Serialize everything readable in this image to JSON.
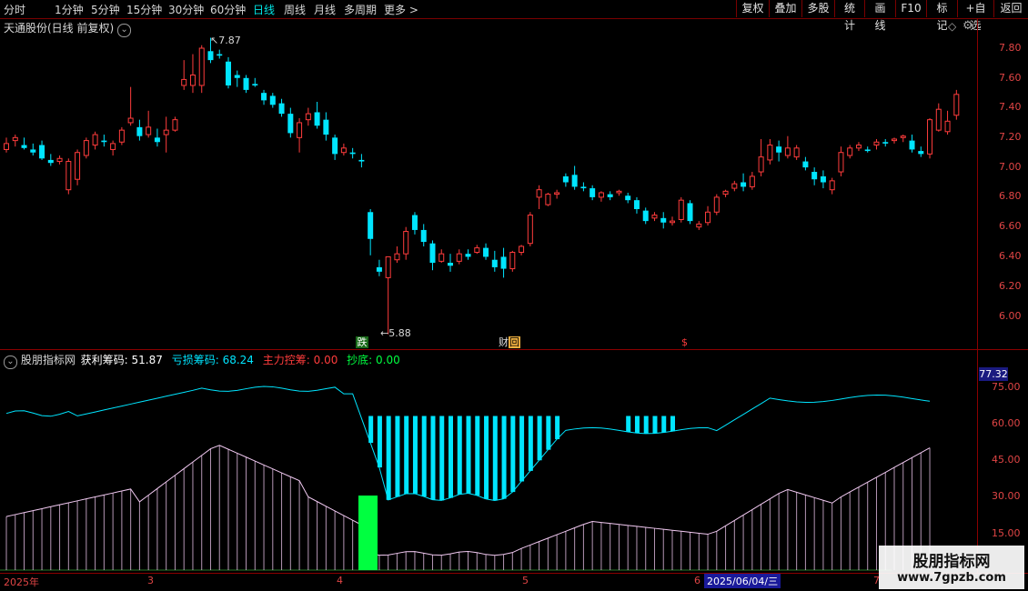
{
  "toolbar": {
    "periods": [
      "分时",
      "1分钟",
      "5分钟",
      "15分钟",
      "30分钟",
      "60分钟",
      "日线",
      "周线",
      "月线",
      "多周期",
      "更多 >"
    ],
    "active_period": "日线",
    "right_buttons": [
      "复权",
      "叠加",
      "多股",
      "统计",
      "画线",
      "F10",
      "标记",
      "+自选",
      "返回"
    ]
  },
  "main_chart": {
    "title": "天通股份(日线 前复权)",
    "high_label": "7.87",
    "low_label": "5.88",
    "markers": [
      "跌",
      "财",
      "回",
      "$"
    ],
    "y_ticks": [
      "7.80",
      "7.60",
      "7.40",
      "7.20",
      "7.00",
      "6.80",
      "6.60",
      "6.40",
      "6.20",
      "6.00"
    ],
    "colors": {
      "up": "#ff3c3c",
      "down": "#00e5ff",
      "grid": "#7a0000"
    }
  },
  "indicator": {
    "name": "股朋指标网",
    "items": [
      {
        "label": "获利筹码: 51.87",
        "color": "#ffffff"
      },
      {
        "label": "亏损筹码: 68.24",
        "color": "#00e5ff"
      },
      {
        "label": "主力控筹: 0.00",
        "color": "#ff3c3c"
      },
      {
        "label": "抄底: 0.00",
        "color": "#00ff40"
      }
    ],
    "current_value": "77.32",
    "y_ticks": [
      "75.00",
      "60.00",
      "45.00",
      "30.00",
      "15.00"
    ],
    "colors": {
      "profit": "#f0c8f0",
      "loss": "#00e5ff",
      "bottom": "#00ff40"
    }
  },
  "time_axis": {
    "labels": [
      "2025年",
      "3",
      "4",
      "5",
      "6",
      "7"
    ],
    "cursor_date": "2025/06/04/三"
  },
  "watermark": {
    "line1": "股朋指标网",
    "line2": "www.7gpzb.com"
  },
  "chart_data": {
    "type": "candlestick",
    "ohlc": [
      [
        7.12,
        7.2,
        7.1,
        7.16
      ],
      [
        7.18,
        7.22,
        7.14,
        7.2
      ],
      [
        7.15,
        7.2,
        7.12,
        7.13
      ],
      [
        7.12,
        7.16,
        7.08,
        7.1
      ],
      [
        7.15,
        7.18,
        7.05,
        7.06
      ],
      [
        7.05,
        7.09,
        7.01,
        7.03
      ],
      [
        7.04,
        7.08,
        7.02,
        7.06
      ],
      [
        6.85,
        7.06,
        6.82,
        7.04
      ],
      [
        6.92,
        7.12,
        6.88,
        7.1
      ],
      [
        7.08,
        7.2,
        7.06,
        7.18
      ],
      [
        7.15,
        7.24,
        7.12,
        7.22
      ],
      [
        7.18,
        7.22,
        7.14,
        7.17
      ],
      [
        7.12,
        7.18,
        7.08,
        7.16
      ],
      [
        7.17,
        7.27,
        7.15,
        7.25
      ],
      [
        7.3,
        7.54,
        7.28,
        7.33
      ],
      [
        7.27,
        7.32,
        7.18,
        7.21
      ],
      [
        7.22,
        7.38,
        7.2,
        7.27
      ],
      [
        7.2,
        7.26,
        7.14,
        7.17
      ],
      [
        7.22,
        7.34,
        7.1,
        7.25
      ],
      [
        7.25,
        7.34,
        7.24,
        7.32
      ],
      [
        7.55,
        7.72,
        7.52,
        7.59
      ],
      [
        7.55,
        7.76,
        7.5,
        7.62
      ],
      [
        7.55,
        7.82,
        7.5,
        7.8
      ],
      [
        7.78,
        7.87,
        7.7,
        7.72
      ],
      [
        7.76,
        7.79,
        7.73,
        7.75
      ],
      [
        7.71,
        7.74,
        7.53,
        7.55
      ],
      [
        7.62,
        7.65,
        7.54,
        7.6
      ],
      [
        7.6,
        7.62,
        7.5,
        7.52
      ],
      [
        7.56,
        7.6,
        7.54,
        7.55
      ],
      [
        7.5,
        7.52,
        7.42,
        7.45
      ],
      [
        7.48,
        7.5,
        7.4,
        7.42
      ],
      [
        7.43,
        7.46,
        7.34,
        7.36
      ],
      [
        7.36,
        7.4,
        7.2,
        7.23
      ],
      [
        7.2,
        7.33,
        7.1,
        7.3
      ],
      [
        7.32,
        7.4,
        7.28,
        7.36
      ],
      [
        7.37,
        7.44,
        7.26,
        7.28
      ],
      [
        7.32,
        7.37,
        7.18,
        7.22
      ],
      [
        7.2,
        7.22,
        7.05,
        7.09
      ],
      [
        7.1,
        7.16,
        7.08,
        7.13
      ],
      [
        7.1,
        7.13,
        7.06,
        7.09
      ],
      [
        7.05,
        7.09,
        7.0,
        7.04
      ],
      [
        6.7,
        6.72,
        6.41,
        6.52
      ],
      [
        6.33,
        6.38,
        6.27,
        6.3
      ],
      [
        6.26,
        6.4,
        5.88,
        6.4
      ],
      [
        6.38,
        6.47,
        6.36,
        6.42
      ],
      [
        6.42,
        6.6,
        6.38,
        6.57
      ],
      [
        6.68,
        6.7,
        6.55,
        6.58
      ],
      [
        6.58,
        6.62,
        6.47,
        6.5
      ],
      [
        6.49,
        6.51,
        6.31,
        6.36
      ],
      [
        6.37,
        6.45,
        6.36,
        6.42
      ],
      [
        6.36,
        6.42,
        6.3,
        6.34
      ],
      [
        6.37,
        6.45,
        6.35,
        6.42
      ],
      [
        6.42,
        6.45,
        6.38,
        6.4
      ],
      [
        6.43,
        6.48,
        6.42,
        6.46
      ],
      [
        6.46,
        6.49,
        6.38,
        6.4
      ],
      [
        6.38,
        6.44,
        6.3,
        6.33
      ],
      [
        6.4,
        6.46,
        6.26,
        6.32
      ],
      [
        6.32,
        6.44,
        6.3,
        6.43
      ],
      [
        6.43,
        6.48,
        6.41,
        6.47
      ],
      [
        6.49,
        6.7,
        6.47,
        6.68
      ],
      [
        6.8,
        6.88,
        6.72,
        6.85
      ],
      [
        6.75,
        6.83,
        6.74,
        6.82
      ],
      [
        6.82,
        6.85,
        6.79,
        6.83
      ],
      [
        6.94,
        6.96,
        6.87,
        6.9
      ],
      [
        6.95,
        7.01,
        6.85,
        6.87
      ],
      [
        6.87,
        6.9,
        6.84,
        6.86
      ],
      [
        6.86,
        6.88,
        6.78,
        6.8
      ],
      [
        6.8,
        6.84,
        6.77,
        6.83
      ],
      [
        6.82,
        6.84,
        6.78,
        6.8
      ],
      [
        6.83,
        6.85,
        6.81,
        6.84
      ],
      [
        6.81,
        6.83,
        6.76,
        6.78
      ],
      [
        6.78,
        6.8,
        6.69,
        6.72
      ],
      [
        6.71,
        6.73,
        6.62,
        6.64
      ],
      [
        6.66,
        6.7,
        6.64,
        6.68
      ],
      [
        6.66,
        6.7,
        6.59,
        6.63
      ],
      [
        6.63,
        6.67,
        6.61,
        6.64
      ],
      [
        6.65,
        6.8,
        6.63,
        6.78
      ],
      [
        6.76,
        6.78,
        6.62,
        6.64
      ],
      [
        6.6,
        6.64,
        6.58,
        6.62
      ],
      [
        6.63,
        6.74,
        6.61,
        6.7
      ],
      [
        6.7,
        6.82,
        6.68,
        6.8
      ],
      [
        6.82,
        6.85,
        6.8,
        6.84
      ],
      [
        6.86,
        6.91,
        6.84,
        6.89
      ],
      [
        6.9,
        6.96,
        6.84,
        6.87
      ],
      [
        6.87,
        6.97,
        6.85,
        6.94
      ],
      [
        6.97,
        7.19,
        6.94,
        7.07
      ],
      [
        7.05,
        7.19,
        7.02,
        7.15
      ],
      [
        7.14,
        7.18,
        7.04,
        7.1
      ],
      [
        7.08,
        7.21,
        7.06,
        7.13
      ],
      [
        7.07,
        7.15,
        7.05,
        7.13
      ],
      [
        7.04,
        7.07,
        6.98,
        7.0
      ],
      [
        6.97,
        7.0,
        6.88,
        6.92
      ],
      [
        6.94,
        6.98,
        6.86,
        6.9
      ],
      [
        6.85,
        6.93,
        6.82,
        6.91
      ],
      [
        6.97,
        7.14,
        6.94,
        7.1
      ],
      [
        7.08,
        7.15,
        7.06,
        7.13
      ],
      [
        7.13,
        7.17,
        7.11,
        7.15
      ],
      [
        7.12,
        7.14,
        7.1,
        7.11
      ],
      [
        7.15,
        7.19,
        7.12,
        7.17
      ],
      [
        7.17,
        7.19,
        7.14,
        7.16
      ],
      [
        7.18,
        7.2,
        7.16,
        7.19
      ],
      [
        7.2,
        7.22,
        7.17,
        7.21
      ],
      [
        7.18,
        7.22,
        7.1,
        7.12
      ],
      [
        7.11,
        7.14,
        7.07,
        7.09
      ],
      [
        7.09,
        7.33,
        7.06,
        7.32
      ],
      [
        7.25,
        7.43,
        7.24,
        7.39
      ],
      [
        7.24,
        7.38,
        7.22,
        7.31
      ],
      [
        7.35,
        7.52,
        7.32,
        7.49
      ]
    ],
    "ylim": [
      5.82,
      7.95
    ]
  }
}
